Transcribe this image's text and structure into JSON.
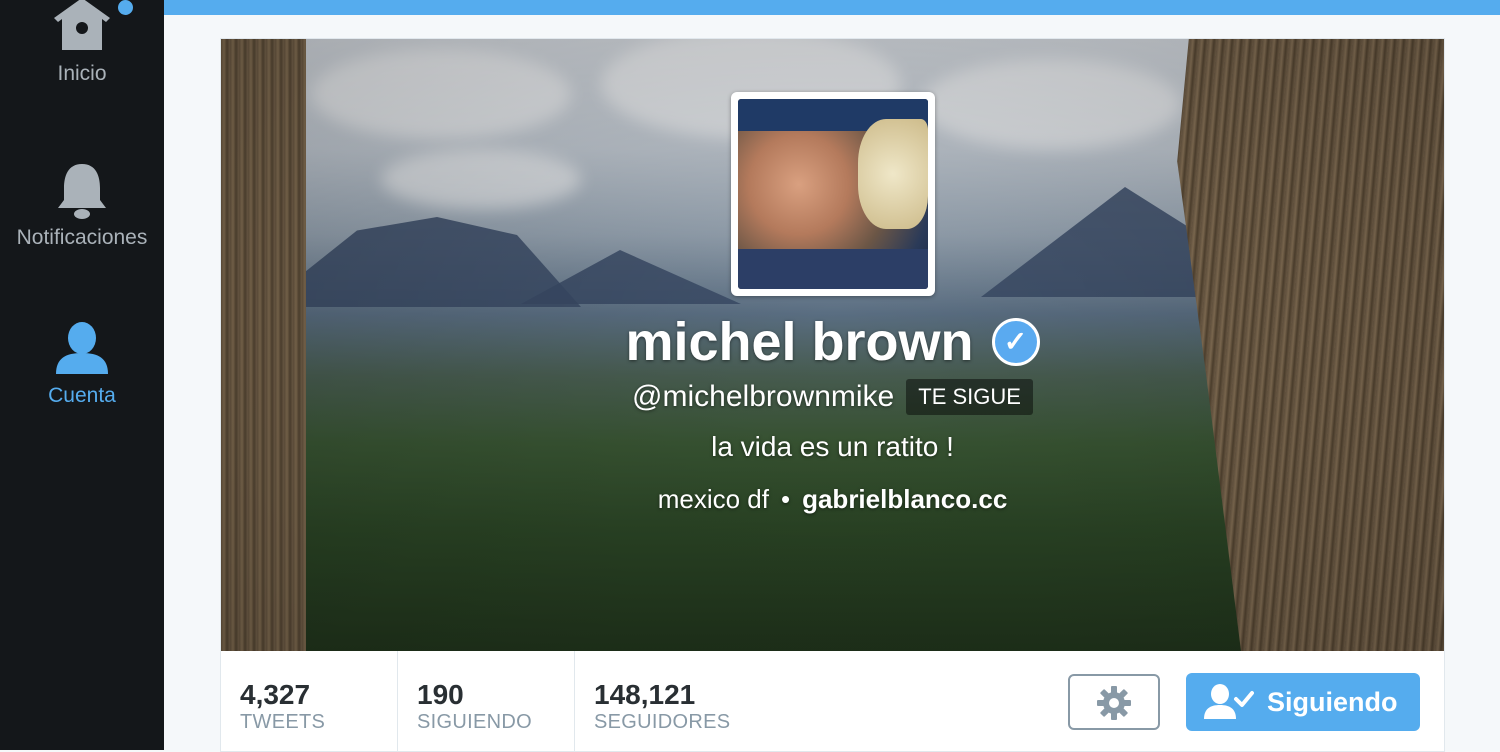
{
  "sidebar": {
    "items": [
      {
        "label": "Inicio",
        "icon": "birdhouse-icon"
      },
      {
        "label": "Notificaciones",
        "icon": "bell-icon"
      },
      {
        "label": "Cuenta",
        "icon": "person-icon",
        "active": true
      }
    ]
  },
  "profile": {
    "name": "michel brown",
    "verified": true,
    "handle": "@michelbrownmike",
    "follows_you": "TE SIGUE",
    "bio": "la vida es un ratito !",
    "location": "mexico df",
    "separator": "•",
    "url": "gabrielblanco.cc"
  },
  "stats": [
    {
      "value": "4,327",
      "label": "TWEETS"
    },
    {
      "value": "190",
      "label": "SIGUIENDO"
    },
    {
      "value": "148,121",
      "label": "SEGUIDORES"
    }
  ],
  "actions": {
    "settings_icon": "gear-icon",
    "follow_label": "Siguiendo",
    "follow_icon": "person-check-icon"
  },
  "colors": {
    "accent": "#55acee",
    "sidebar_bg": "#14171a",
    "muted": "#8899a6"
  }
}
